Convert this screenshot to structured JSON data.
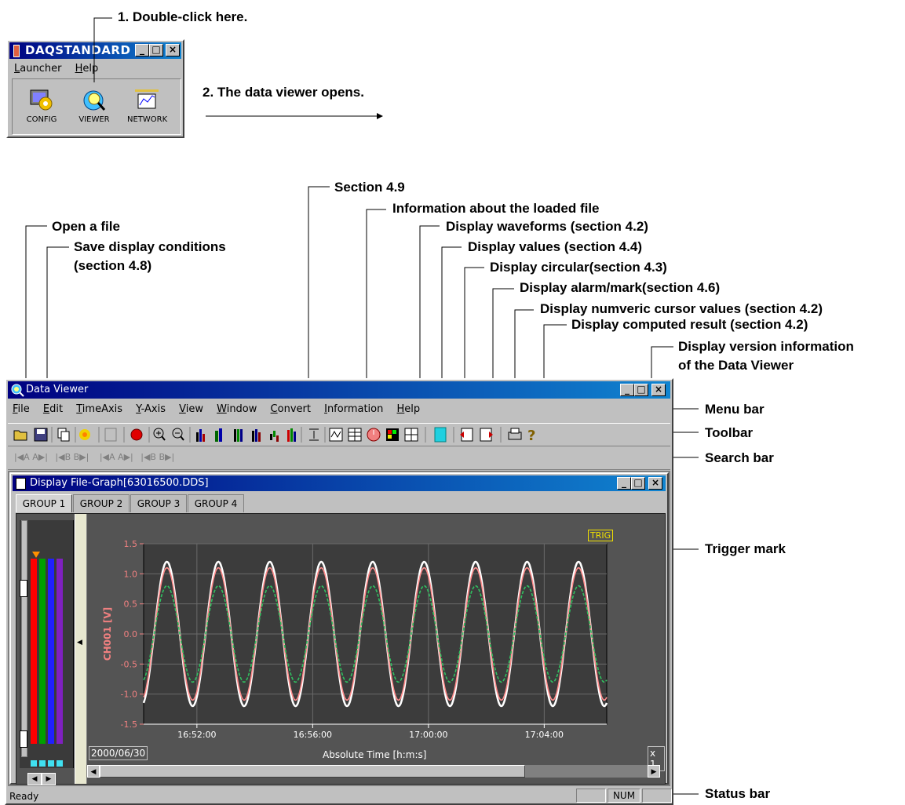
{
  "launcher": {
    "title": "DAQSTANDARD",
    "menu": [
      "Launcher",
      "Help"
    ],
    "icons": [
      {
        "label": "CONFIG",
        "icon": "config-icon"
      },
      {
        "label": "VIEWER",
        "icon": "viewer-icon"
      },
      {
        "label": "NETWORK",
        "icon": "network-icon"
      }
    ]
  },
  "steps": {
    "step1": "1. Double-click here.",
    "step2": "2. The data viewer opens."
  },
  "callouts": {
    "section49": "Section 4.9",
    "info_loaded": "Information about the loaded file",
    "open_file": "Open a file",
    "save_display": "Save display conditions",
    "save_display_2": "(section 4.8)",
    "waveforms": "Display waveforms (section 4.2)",
    "values": "Display values (section 4.4)",
    "circular": "Display circular(section 4.3)",
    "alarm": "Display alarm/mark(section 4.6)",
    "cursor": "Display numveric cursor values (section 4.2)",
    "computed": "Display computed result (section 4.2)",
    "version": "Display version information",
    "version_2": "of the Data Viewer",
    "menu_bar": "Menu bar",
    "toolbar": "Toolbar",
    "search_bar": "Search bar",
    "trigger_mark": "Trigger mark",
    "status_bar": "Status bar"
  },
  "viewer": {
    "title": "Data Viewer",
    "menu": [
      "File",
      "Edit",
      "TimeAxis",
      "Y-Axis",
      "View",
      "Window",
      "Convert",
      "Information",
      "Help"
    ],
    "search_buttons": [
      "|◀A",
      "A▶|",
      "|◀B",
      "B▶|",
      "|◀A",
      "A▶|",
      "|◀B",
      "B▶|"
    ],
    "child_title": "Display File-Graph[63016500.DDS]",
    "tabs": [
      "GROUP 1",
      "GROUP 2",
      "GROUP 3",
      "GROUP 4"
    ],
    "trig_label": "TRIG",
    "date_label": "2000/06/30",
    "zoom_label": "x 1",
    "status": {
      "ready": "Ready",
      "num": "NUM"
    }
  },
  "chart_data": {
    "type": "line",
    "ylabel": "CH001 [V]",
    "xlabel": "Absolute Time [h:m:s]",
    "yticks": [
      "1.5",
      "1.0",
      "0.5",
      "0.0",
      "-0.5",
      "-1.0",
      "-1.5"
    ],
    "xticks": [
      "16:52:00",
      "16:56:00",
      "17:00:00",
      "17:04:00"
    ],
    "ylim": [
      -1.5,
      1.5
    ],
    "series": [
      {
        "name": "",
        "color": "#ffffff",
        "amplitude": 1.2,
        "cycles": 9
      },
      {
        "name": "",
        "color": "#ff8c8c",
        "amplitude": 1.1,
        "cycles": 9
      },
      {
        "name": "",
        "color": "#30c060",
        "amplitude": 0.8,
        "cycles": 9
      }
    ],
    "grid": true,
    "level_bar_colors": [
      "#ff0000",
      "#00a000",
      "#2020ff",
      "#8020c0"
    ]
  },
  "colors": {
    "plot_bg": "#3c3c3c",
    "graph_bg": "#545454",
    "title_blue": "#000080"
  }
}
